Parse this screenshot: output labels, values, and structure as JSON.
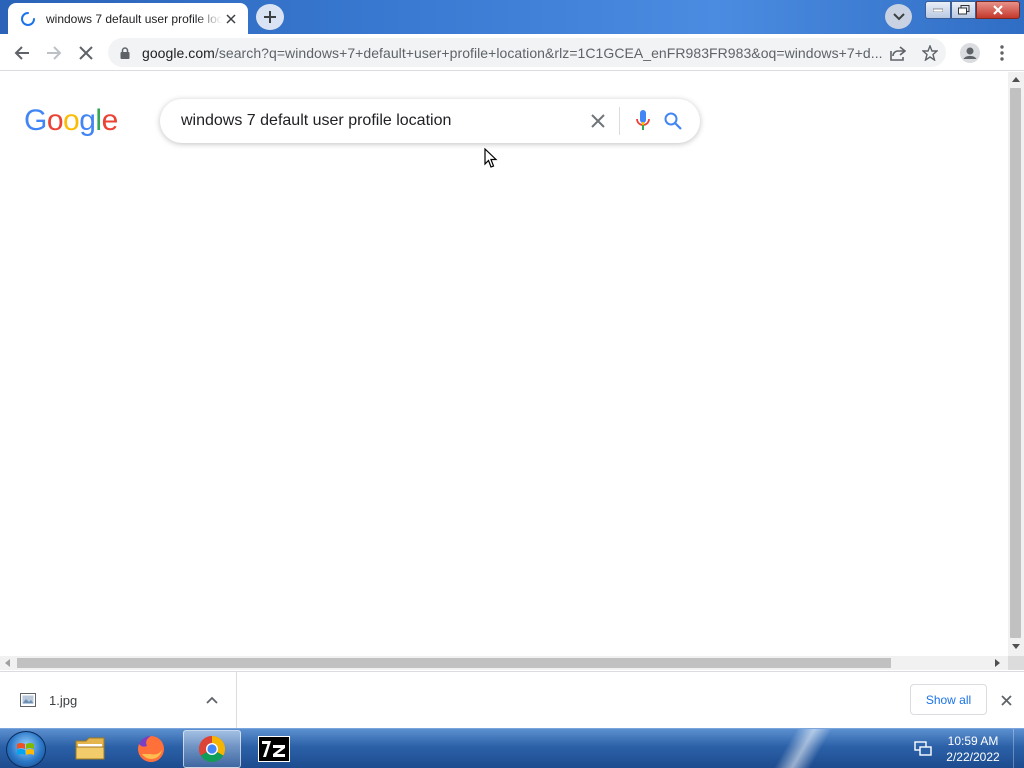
{
  "tab": {
    "title": "windows 7 default user profile location"
  },
  "omnibox": {
    "host": "google.com",
    "path": "/search?q=windows+7+default+user+profile+location&rlz=1C1GCEA_enFR983FR983&oq=windows+7+d..."
  },
  "search": {
    "query": "windows 7 default user profile location"
  },
  "logo": {
    "letters": [
      "G",
      "o",
      "o",
      "g",
      "l",
      "e"
    ],
    "colors": [
      "#4285F4",
      "#EA4335",
      "#FBBC05",
      "#4285F4",
      "#34A853",
      "#EA4335"
    ]
  },
  "downloads": {
    "file_name": "1.jpg",
    "show_all_label": "Show all"
  },
  "taskbar": {
    "time": "10:59 AM",
    "date": "2/22/2022"
  },
  "colors": {
    "accent": "#1a73e8",
    "titlebar": "#3a7ad2",
    "taskbar": "#2c61a8"
  }
}
